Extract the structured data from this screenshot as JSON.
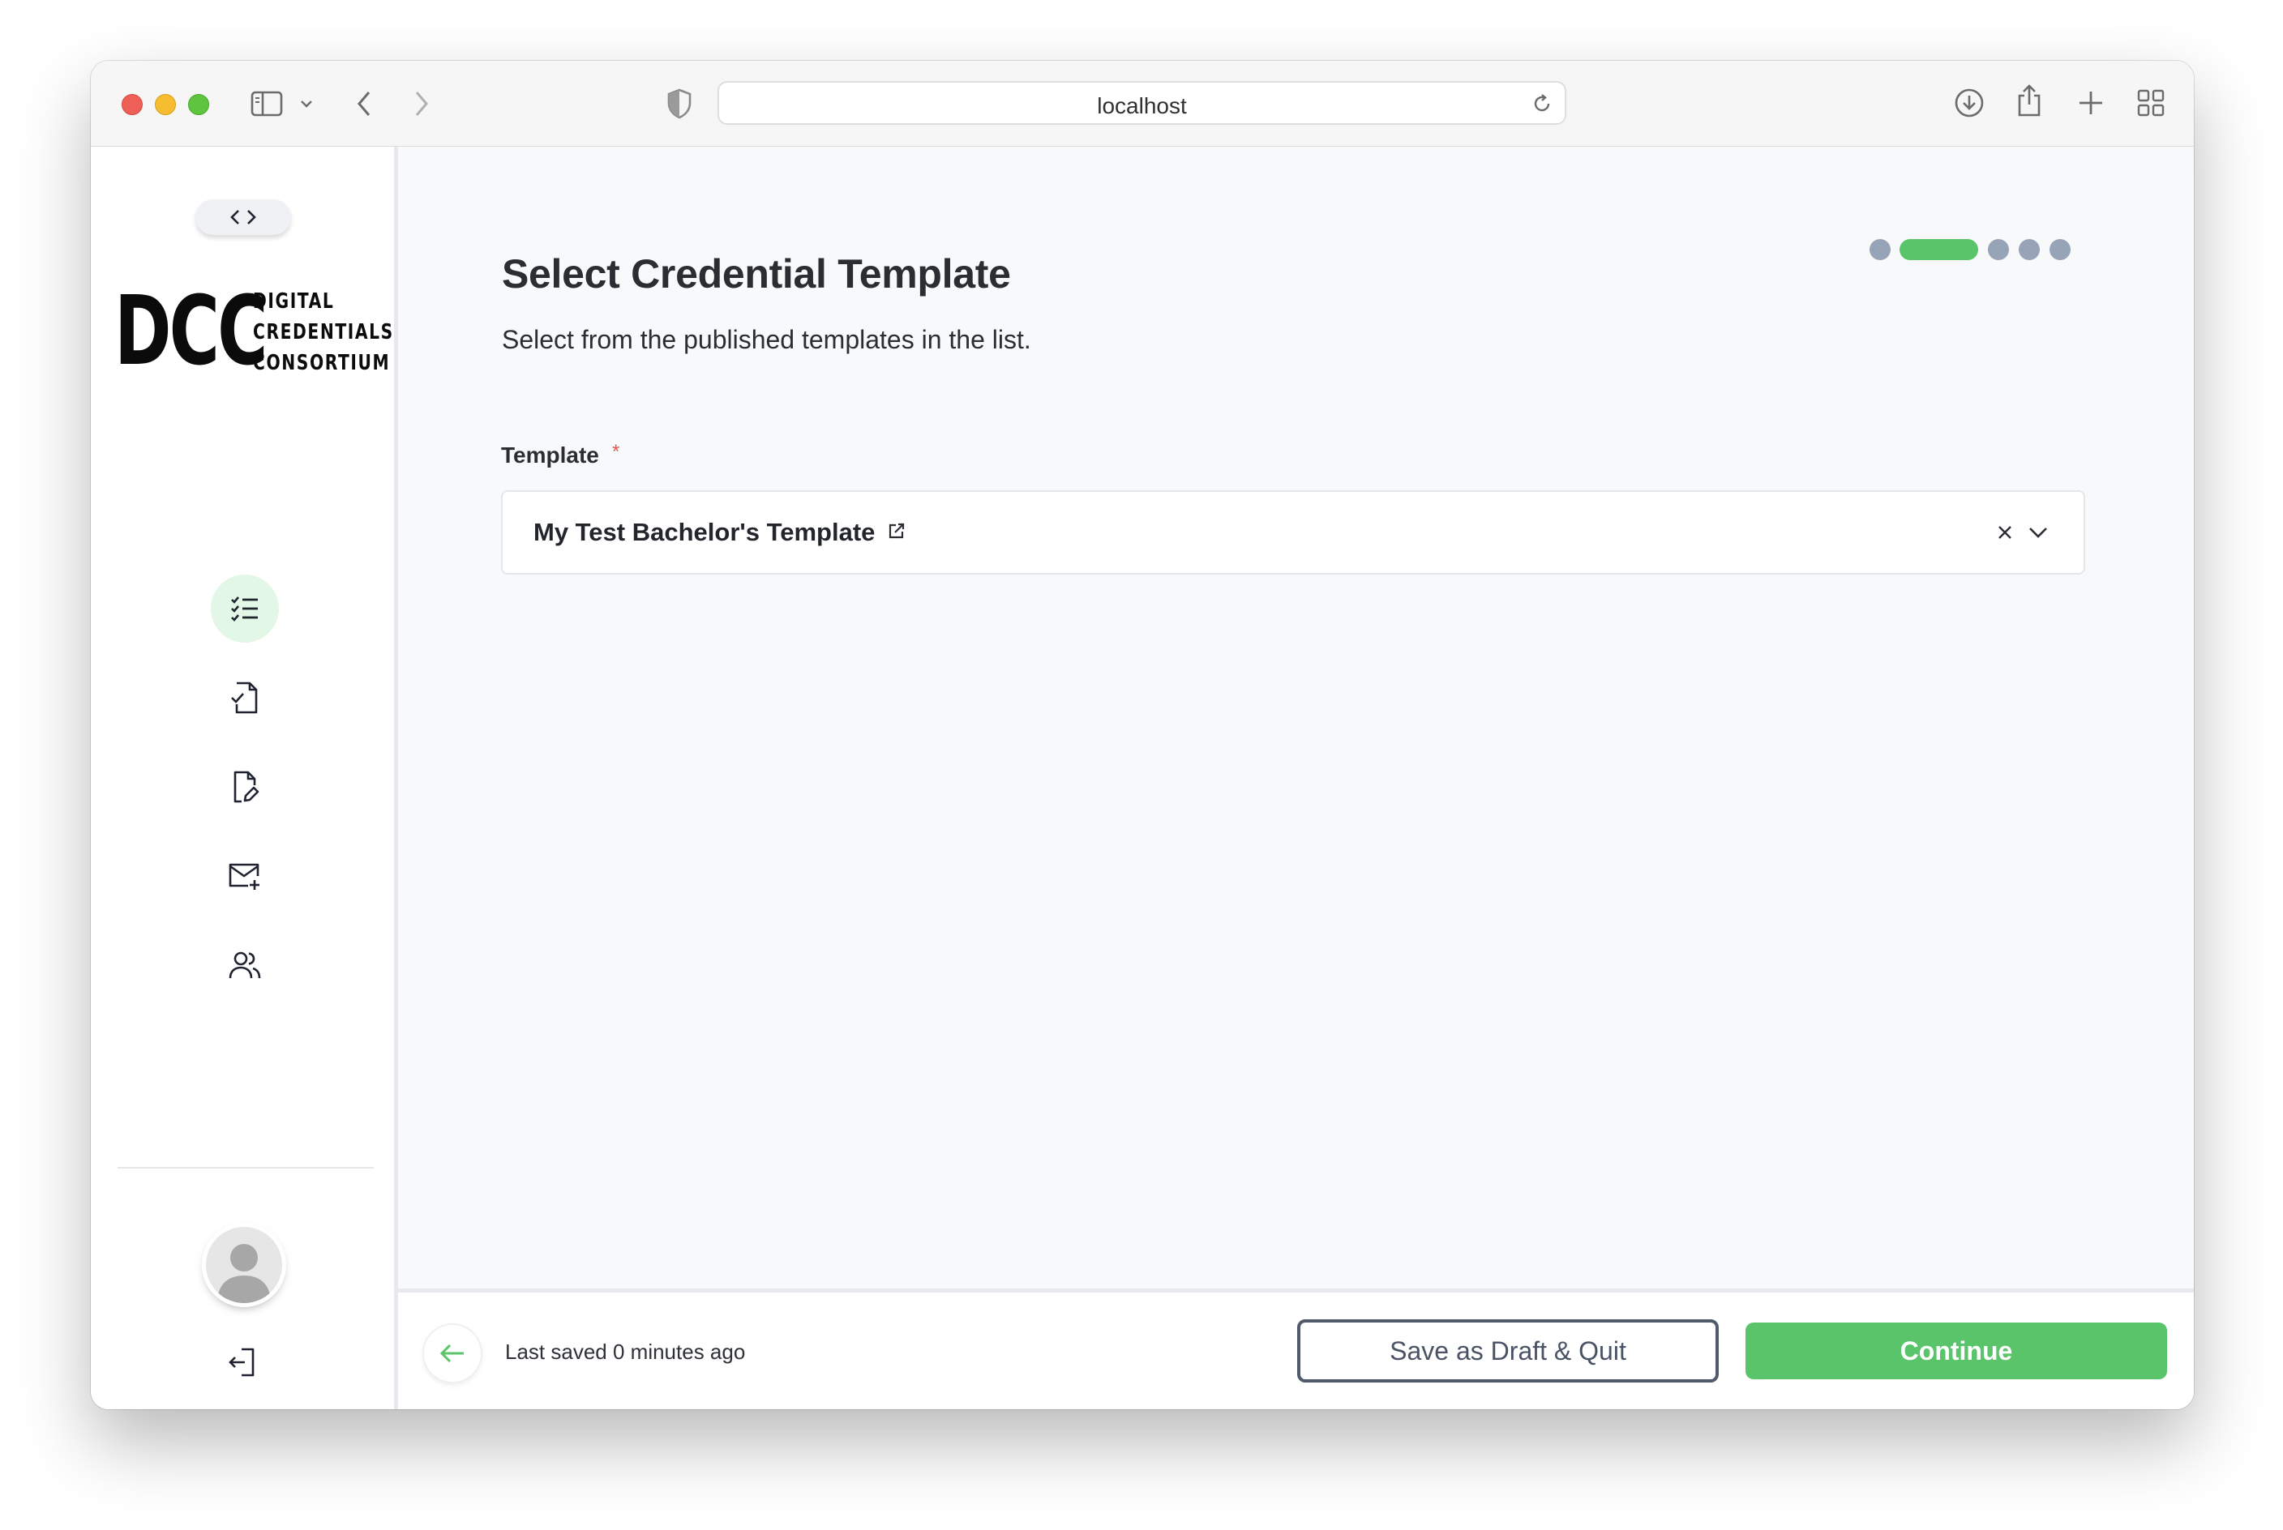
{
  "browser": {
    "address_text": "localhost"
  },
  "sidebar": {
    "logo": {
      "abbr": "DCC",
      "line1": "DIGITAL",
      "line2": "CREDENTIALS",
      "line3": "CONSORTIUM"
    },
    "nav_icons": [
      "list-icon",
      "file-check-icon",
      "file-edit-icon",
      "mail-plus-icon",
      "users-icon"
    ],
    "active_nav": "list-icon"
  },
  "main": {
    "stepper": {
      "total_steps": 5,
      "current_step": 2
    },
    "title": "Select Credential Template",
    "subtitle": "Select from the published templates in the list.",
    "template_field": {
      "label": "Template",
      "required_marker": "*",
      "selected_value": "My Test Bachelor's Template"
    }
  },
  "footer": {
    "last_saved": "Last saved 0 minutes ago",
    "save_draft_label": "Save as Draft & Quit",
    "continue_label": "Continue"
  },
  "colors": {
    "accent_green": "#5ac46a",
    "active_nav_bg": "#e2f7e6",
    "stepper_inactive": "#97a3b6",
    "required_red": "#e25555"
  }
}
